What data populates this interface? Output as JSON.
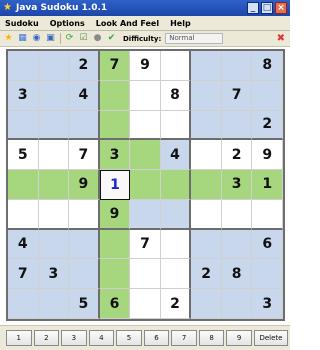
{
  "window": {
    "title": "Java Sudoku 1.0.1",
    "min_label": "_",
    "max_label": "□",
    "close_label": "×"
  },
  "menu": [
    "Sudoku",
    "Options",
    "Look And Feel",
    "Help"
  ],
  "toolbar": {
    "difficulty_label": "Difficulty:",
    "difficulty_value": "Normal"
  },
  "board": {
    "rows": [
      [
        "",
        "",
        "2",
        "7",
        "9",
        "",
        "",
        "",
        "8"
      ],
      [
        "3",
        "",
        "4",
        "",
        "",
        "8",
        "",
        "7",
        ""
      ],
      [
        "",
        "",
        "",
        "",
        "",
        "",
        "",
        "",
        "2"
      ],
      [
        "5",
        "",
        "7",
        "3",
        "",
        "4",
        "",
        "2",
        "9"
      ],
      [
        "",
        "",
        "9",
        "1",
        "",
        "",
        "",
        "3",
        "1"
      ],
      [
        "",
        "",
        "",
        "9",
        "",
        "",
        "",
        "",
        ""
      ],
      [
        "4",
        "",
        "",
        "",
        "7",
        "",
        "",
        "",
        "6"
      ],
      [
        "7",
        "3",
        "",
        "",
        "",
        "",
        "2",
        "8",
        ""
      ],
      [
        "",
        "",
        "5",
        "6",
        "",
        "2",
        "",
        "",
        "3"
      ]
    ],
    "selected_row": 4,
    "selected_col": 3
  },
  "keypad": [
    "1",
    "2",
    "3",
    "4",
    "5",
    "6",
    "7",
    "8",
    "9",
    "Delete"
  ],
  "colors": {
    "blue": "#c8d7ec",
    "white": "#ffffff",
    "green": "#a6d67d"
  },
  "icons": {
    "app": "star-icon",
    "toolbar": [
      "star-icon",
      "grid-icon",
      "circle-icon",
      "save-icon",
      "refresh-icon",
      "checkbox-icon",
      "record-icon",
      "check-icon"
    ]
  }
}
